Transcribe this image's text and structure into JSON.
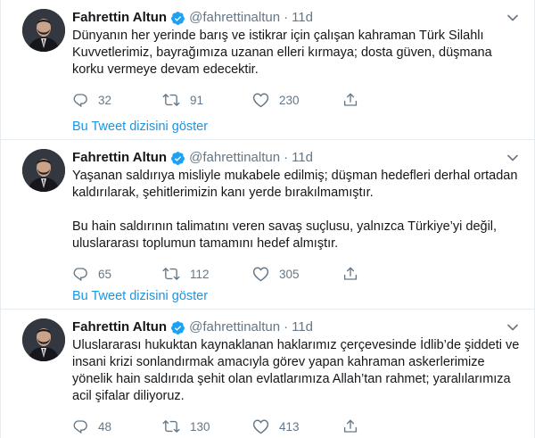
{
  "colors": {
    "accent": "#1da1f2",
    "link": "#1b95e0",
    "muted": "#657786",
    "text": "#14171a",
    "border": "#e6ecf0"
  },
  "icons": {
    "verified": "verified-badge-icon",
    "caret": "chevron-down-icon",
    "reply": "reply-icon",
    "retweet": "retweet-icon",
    "like": "like-heart-icon",
    "share": "share-icon"
  },
  "tweets": [
    {
      "author": "Fahrettin Altun",
      "handle": "@fahrettinaltun",
      "separator": "·",
      "time": "11d",
      "paragraphs": [
        "Dünyanın her yerinde barış ve istikrar için çalışan kahraman Türk Silahlı Kuvvetlerimiz, bayrağımıza uzanan elleri kırmaya; dosta güven, düşmana korku vermeye devam edecektir."
      ],
      "replies": "32",
      "retweets": "91",
      "likes": "230",
      "thread_link": "Bu Tweet dizisini göster"
    },
    {
      "author": "Fahrettin Altun",
      "handle": "@fahrettinaltun",
      "separator": "·",
      "time": "11d",
      "paragraphs": [
        "Yaşanan saldırıya misliyle mukabele edilmiş; düşman hedefleri derhal ortadan kaldırılarak, şehitlerimizin kanı yerde bırakılmamıştır.",
        "Bu hain saldırının talimatını veren savaş suçlusu, yalnızca Türkiye’yi değil, uluslararası toplumun tamamını hedef almıştır."
      ],
      "replies": "65",
      "retweets": "112",
      "likes": "305",
      "thread_link": "Bu Tweet dizisini göster"
    },
    {
      "author": "Fahrettin Altun",
      "handle": "@fahrettinaltun",
      "separator": "·",
      "time": "11d",
      "paragraphs": [
        "Uluslararası hukuktan kaynaklanan haklarımız çerçevesinde İdlib’de şiddeti ve insani krizi sonlandırmak amacıyla görev yapan kahraman askerlerimize yönelik hain saldırıda şehit olan evlatlarımıza Allah’tan rahmet; yaralılarımıza acil şifalar diliyoruz."
      ],
      "replies": "48",
      "retweets": "130",
      "likes": "413"
    }
  ]
}
